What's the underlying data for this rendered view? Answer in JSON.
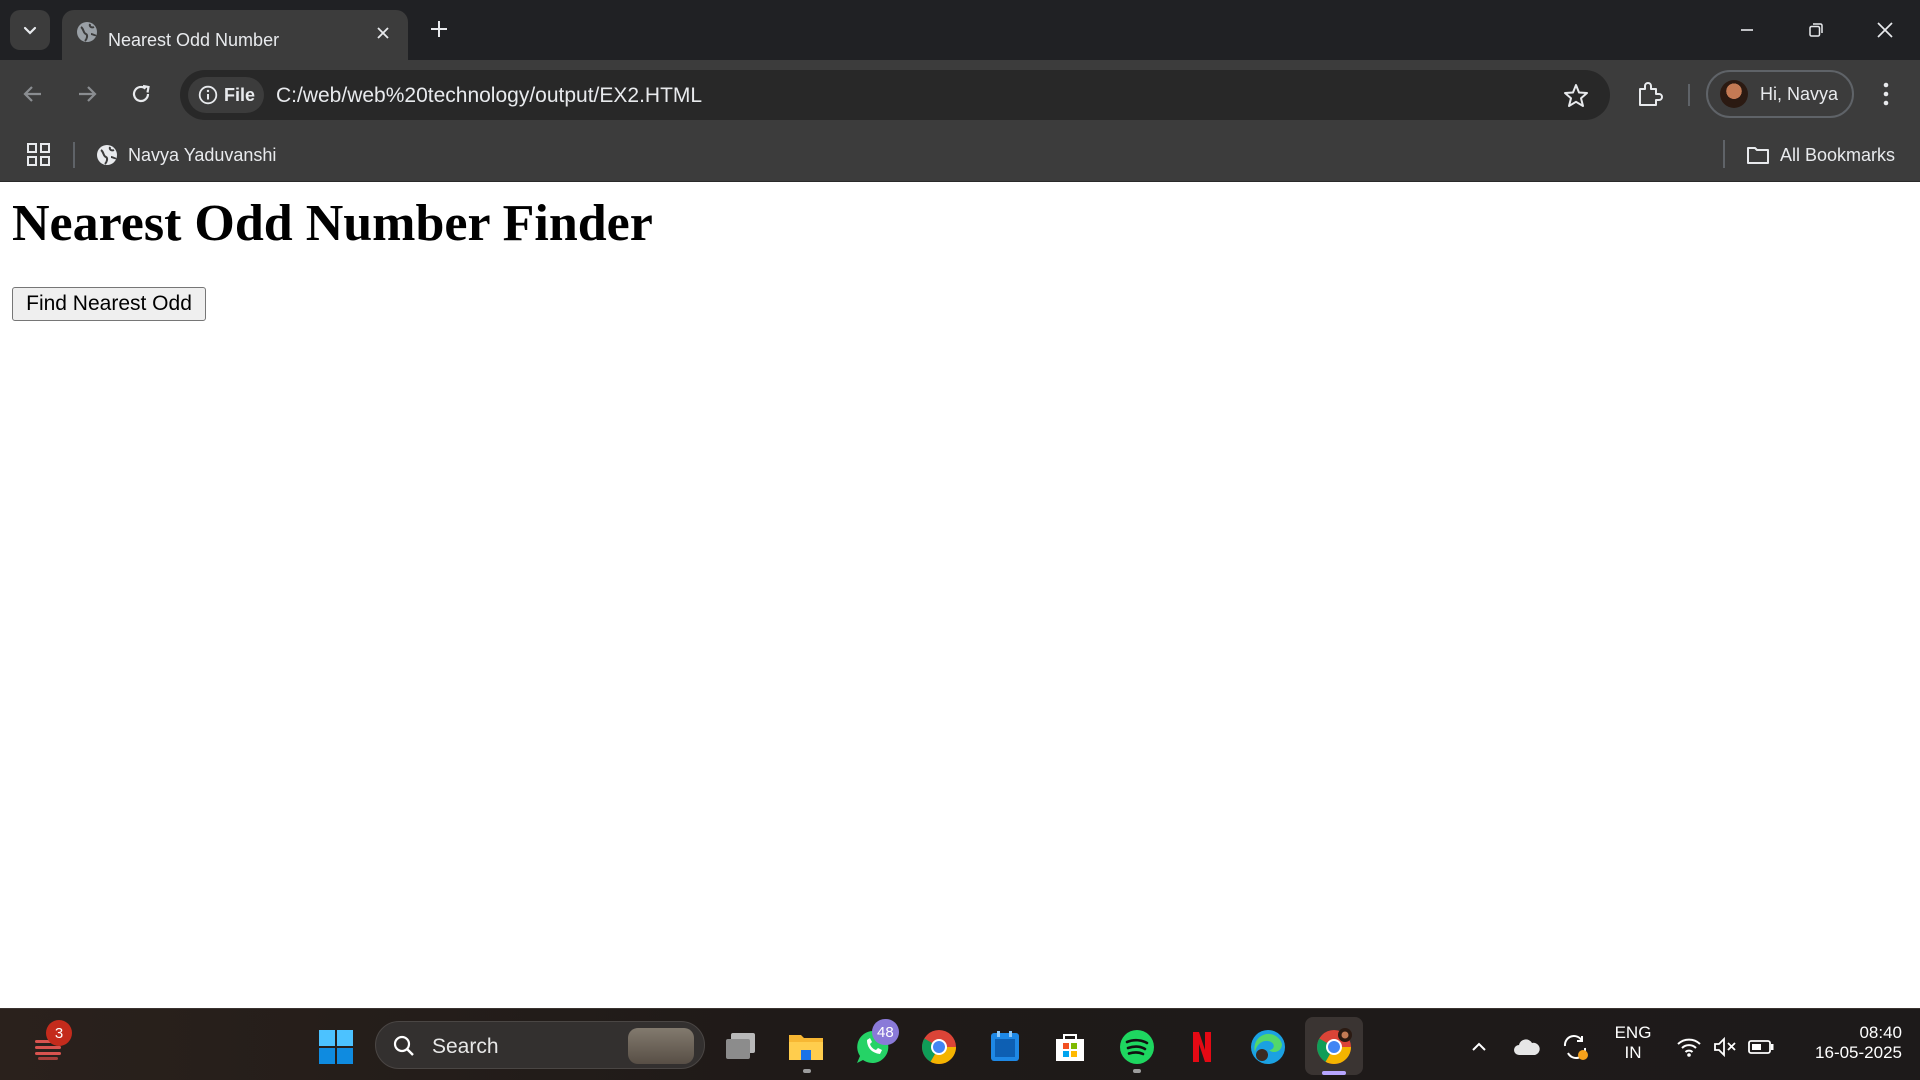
{
  "browser": {
    "tab": {
      "title": "Nearest Odd Number"
    },
    "address": {
      "scheme_chip": "File",
      "url": "C:/web/web%20technology/output/EX2.HTML"
    },
    "profile": {
      "label": "Hi, Navya"
    },
    "bookmarks": {
      "items": [
        {
          "label": "Navya Yaduvanshi",
          "icon": "globe-icon"
        }
      ],
      "all_label": "All Bookmarks"
    }
  },
  "page": {
    "title": "Nearest Odd Number Finder",
    "button_label": "Find Nearest Odd"
  },
  "taskbar": {
    "search_label": "Search",
    "widget_badge": "3",
    "whatsapp_badge": "48",
    "language": {
      "line1": "ENG",
      "line2": "IN"
    },
    "clock": {
      "time": "08:40",
      "date": "16-05-2025"
    }
  },
  "colors": {
    "titlebar": "#202124",
    "toolbar": "#3c3c3c",
    "page_bg": "#ffffff",
    "button_bg": "#efefef",
    "badge_red": "#c42b1c",
    "badge_purple": "#8a7ad8"
  }
}
